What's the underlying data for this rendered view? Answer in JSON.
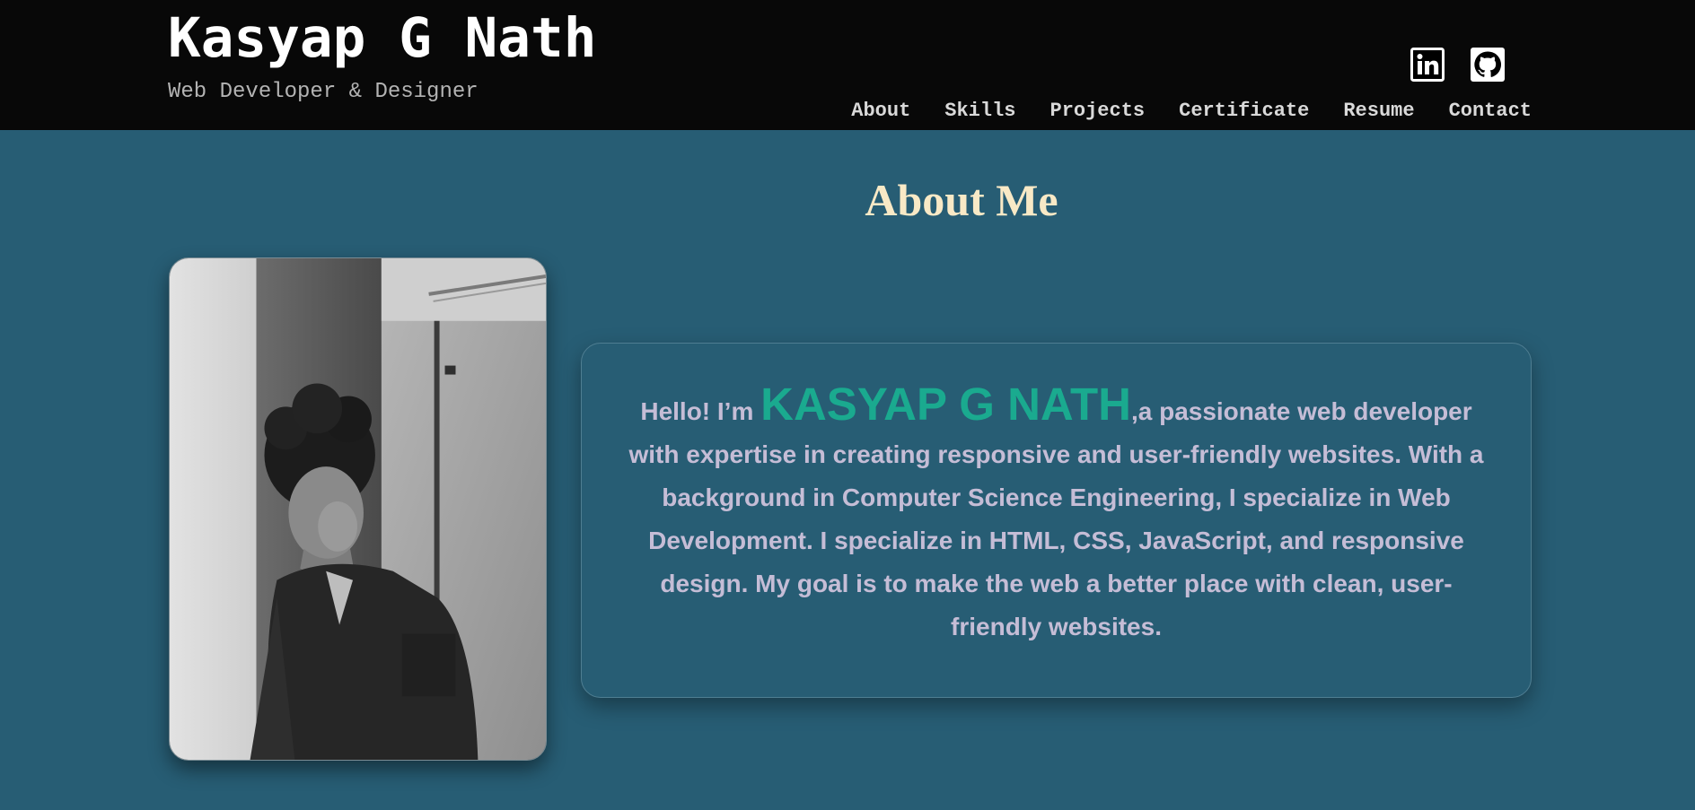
{
  "header": {
    "name": "Kasyap G Nath",
    "tagline": "Web Developer & Designer",
    "social": [
      {
        "icon": "linkedin-icon"
      },
      {
        "icon": "github-icon"
      }
    ],
    "nav": [
      "About",
      "Skills",
      "Projects",
      "Certificate",
      "Resume",
      "Contact"
    ]
  },
  "about": {
    "title": "About Me",
    "photo": "profile-photo",
    "intro": "Hello! I’m ",
    "name": "KASYAP G NATH",
    "bio": ",a passionate web developer with expertise in creating responsive and user-friendly websites. With a background in Computer Science Engineering, I specialize in Web Development. I specialize in HTML, CSS, JavaScript, and responsive design. My goal is to make the web a better place with clean, user-friendly websites."
  },
  "colors": {
    "page_background": "#275d74",
    "header_background": "#080808",
    "title": "#f8e9c6",
    "accent_name": "#1aaa8f",
    "bio_text": "#c5bdd6"
  }
}
